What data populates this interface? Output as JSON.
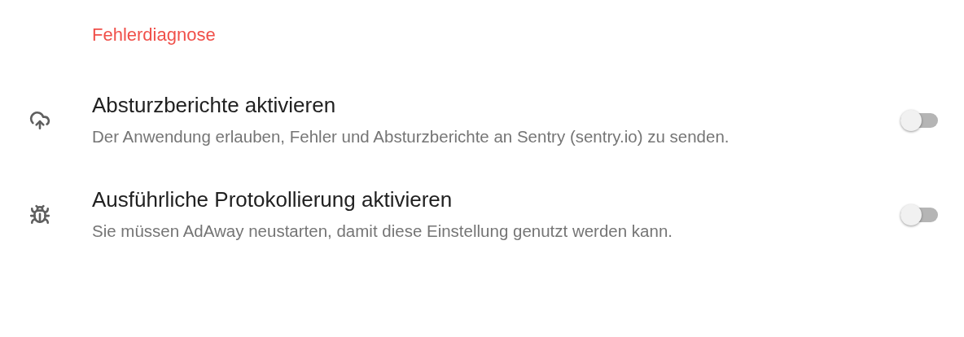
{
  "section": {
    "title": "Fehlerdiagnose"
  },
  "settings": [
    {
      "kind": "upload",
      "title": "Absturzberichte aktivieren",
      "summary": "Der Anwendung erlauben, Fehler und Absturzberichte an Sentry (sentry.io) zu senden.",
      "on": false
    },
    {
      "kind": "bug",
      "title": "Ausführliche Protokollierung aktivieren",
      "summary": "Sie müssen AdAway neustarten, damit diese Einstellung genutzt werden kann.",
      "on": false
    }
  ]
}
